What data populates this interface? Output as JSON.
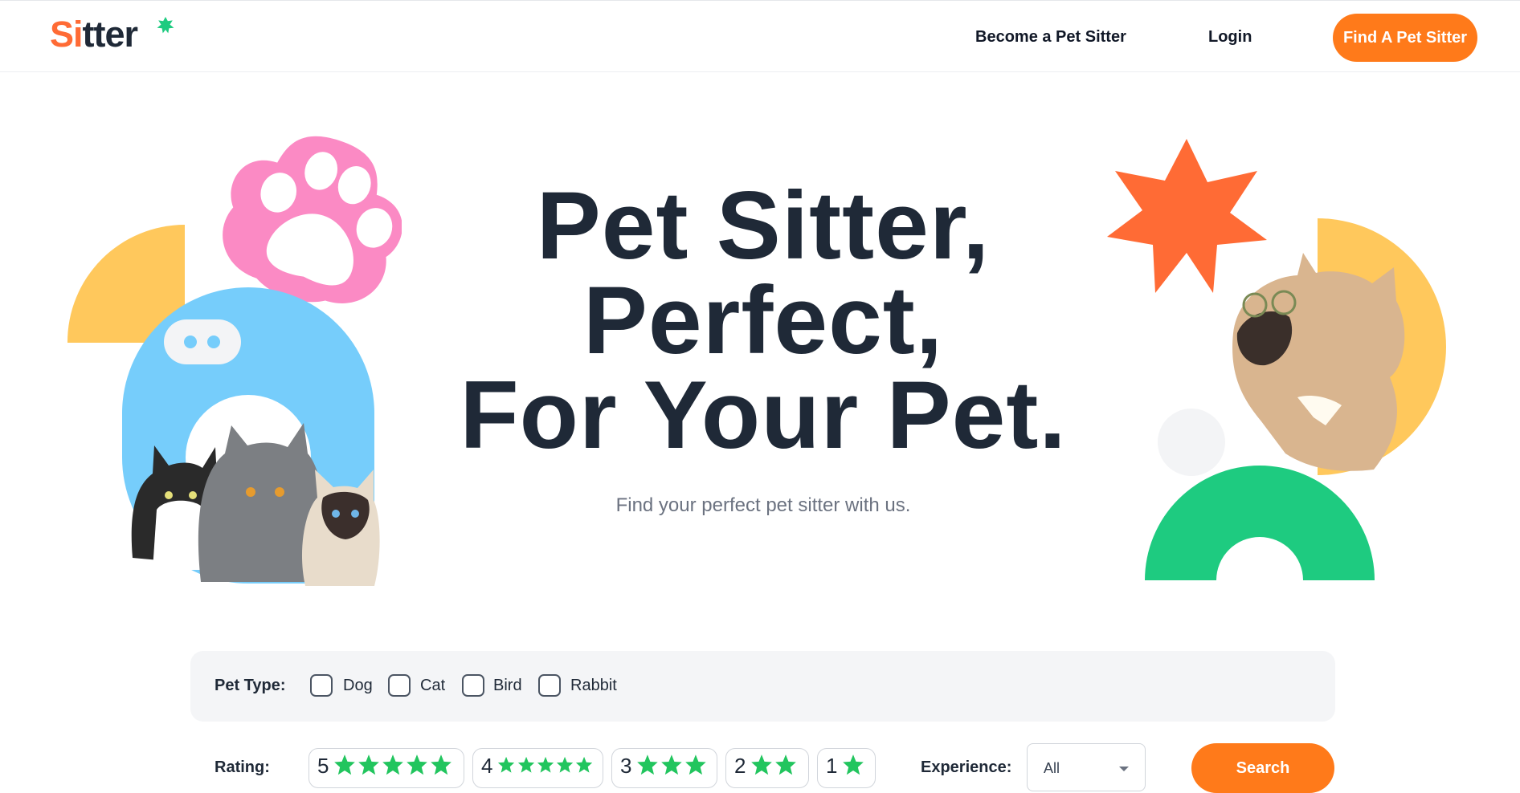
{
  "nav": {
    "logo": {
      "part_orange": "Si",
      "part_dark": "tter"
    },
    "become_label": "Become a Pet Sitter",
    "login_label": "Login",
    "find_label": "Find A Pet Sitter"
  },
  "hero": {
    "title_lines": [
      "Pet Sitter,",
      "Perfect,",
      "For Your Pet."
    ],
    "subtitle": "Find your perfect pet sitter with us."
  },
  "filters": {
    "pet_type_label": "Pet Type:",
    "pet_types": [
      {
        "label": "Dog",
        "checked": false
      },
      {
        "label": "Cat",
        "checked": false
      },
      {
        "label": "Bird",
        "checked": false
      },
      {
        "label": "Rabbit",
        "checked": false
      }
    ],
    "rating_label": "Rating:",
    "ratings": [
      {
        "value": "5",
        "stars": 5
      },
      {
        "value": "4",
        "stars": 5
      },
      {
        "value": "3",
        "stars": 3
      },
      {
        "value": "2",
        "stars": 2
      },
      {
        "value": "1",
        "stars": 1
      }
    ],
    "experience_label": "Experience:",
    "experience_selected": "All",
    "search_label": "Search"
  },
  "colors": {
    "orange": "#ff7a1a",
    "star_green": "#22c55e",
    "dark": "#1f2937",
    "pink": "#fb8ac4",
    "yellow": "#ffc85c",
    "blue": "#76cdfb",
    "green": "#1ecb80"
  },
  "icons": [
    "logo-star-icon",
    "paw-icon",
    "star-icon",
    "chevron-down-icon"
  ]
}
